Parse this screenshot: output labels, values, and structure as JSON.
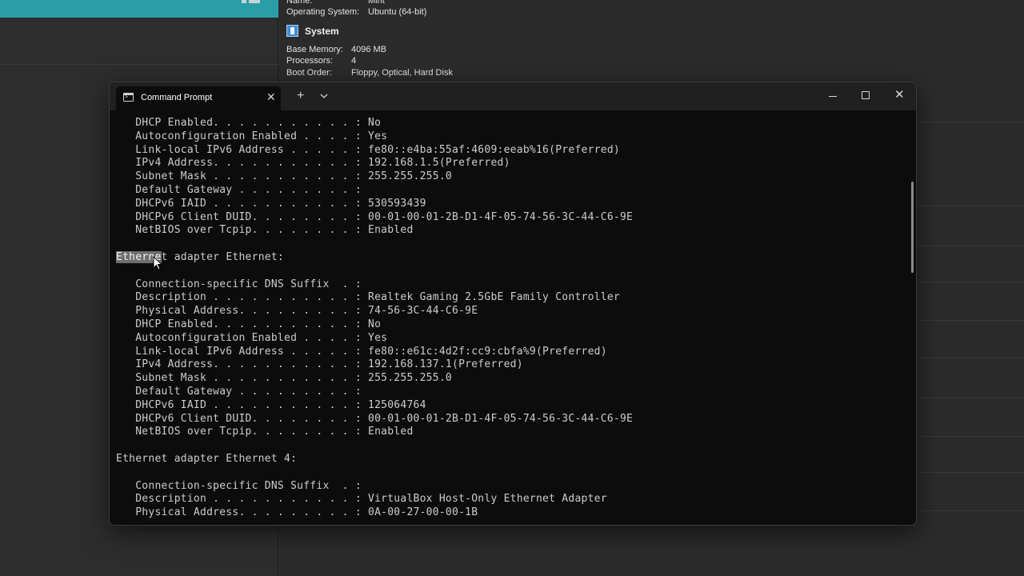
{
  "background": {
    "vm_name_label": "Name:",
    "vm_name_value": "Mint",
    "os_label": "Operating System:",
    "os_value": "Ubuntu (64-bit)",
    "system_title": "System",
    "memory_label": "Base Memory:",
    "memory_value": "4096 MB",
    "processors_label": "Processors:",
    "processors_value": "4",
    "boot_label": "Boot Order:",
    "boot_value": "Floppy, Optical, Hard Disk"
  },
  "terminal": {
    "tab_title": "Command Prompt",
    "tab_close": "✕",
    "new_tab": "+",
    "close_glyph": "✕",
    "lines": [
      "   DHCP Enabled. . . . . . . . . . . : No",
      "   Autoconfiguration Enabled . . . . : Yes",
      "   Link-local IPv6 Address . . . . . : fe80::e4ba:55af:4609:eeab%16(Preferred)",
      "   IPv4 Address. . . . . . . . . . . : 192.168.1.5(Preferred)",
      "   Subnet Mask . . . . . . . . . . . : 255.255.255.0",
      "   Default Gateway . . . . . . . . . :",
      "   DHCPv6 IAID . . . . . . . . . . . : 530593439",
      "   DHCPv6 Client DUID. . . . . . . . : 00-01-00-01-2B-D1-4F-05-74-56-3C-44-C6-9E",
      "   NetBIOS over Tcpip. . . . . . . . : Enabled",
      "",
      "Ethernet adapter Ethernet:",
      "",
      "   Connection-specific DNS Suffix  . :",
      "   Description . . . . . . . . . . . : Realtek Gaming 2.5GbE Family Controller",
      "   Physical Address. . . . . . . . . : 74-56-3C-44-C6-9E",
      "   DHCP Enabled. . . . . . . . . . . : No",
      "   Autoconfiguration Enabled . . . . : Yes",
      "   Link-local IPv6 Address . . . . . : fe80::e61c:4d2f:cc9:cbfa%9(Preferred)",
      "   IPv4 Address. . . . . . . . . . . : 192.168.137.1(Preferred)",
      "   Subnet Mask . . . . . . . . . . . : 255.255.255.0",
      "   Default Gateway . . . . . . . . . :",
      "   DHCPv6 IAID . . . . . . . . . . . : 125064764",
      "   DHCPv6 Client DUID. . . . . . . . : 00-01-00-01-2B-D1-4F-05-74-56-3C-44-C6-9E",
      "   NetBIOS over Tcpip. . . . . . . . : Enabled",
      "",
      "Ethernet adapter Ethernet 4:",
      "",
      "   Connection-specific DNS Suffix  . :",
      "   Description . . . . . . . . . . . : VirtualBox Host-Only Ethernet Adapter",
      "   Physical Address. . . . . . . . . : 0A-00-27-00-00-1B"
    ],
    "selected_text": "Etherne",
    "selected_line_rest": "t adapter Ethernet:",
    "selected_line_index": 10
  },
  "colors": {
    "terminal_bg": "#0c0c0c",
    "terminal_text": "#cccccc",
    "titlebar": "#202020",
    "selection": "#6e6e6e",
    "vbox_accent": "#2a9ea8"
  },
  "icons": [
    "terminal-icon",
    "close-icon",
    "plus-icon",
    "chevron-down-icon",
    "minimize-icon",
    "maximize-icon",
    "system-icon",
    "mouse-cursor-icon"
  ]
}
